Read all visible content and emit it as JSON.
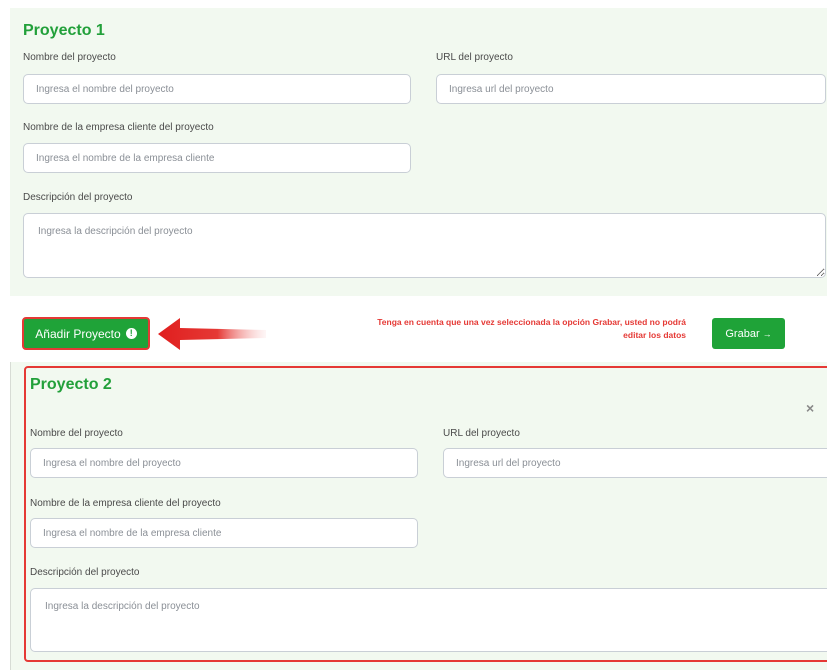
{
  "project1": {
    "title": "Proyecto 1",
    "name_label": "Nombre del proyecto",
    "name_placeholder": "Ingresa el nombre del proyecto",
    "url_label": "URL del proyecto",
    "url_placeholder": "Ingresa url del proyecto",
    "company_label": "Nombre de la empresa cliente del proyecto",
    "company_placeholder": "Ingresa el nombre de la empresa cliente",
    "description_label": "Descripción del proyecto",
    "description_placeholder": "Ingresa la descripción del proyecto"
  },
  "actions": {
    "add_label": "Añadir Proyecto",
    "add_icon": "info-icon",
    "warning_line1": "Tenga en cuenta que una vez seleccionada la opción Grabar, usted no podrá",
    "warning_line2": "editar los datos",
    "save_label": "Grabar",
    "save_arrow": "→"
  },
  "project2": {
    "title": "Proyecto 2",
    "close_glyph": "×",
    "name_label": "Nombre del proyecto",
    "name_placeholder": "Ingresa el nombre del proyecto",
    "url_label": "URL del proyecto",
    "url_placeholder": "Ingresa url del proyecto",
    "company_label": "Nombre de la empresa cliente del proyecto",
    "company_placeholder": "Ingresa el nombre de la empresa cliente",
    "description_label": "Descripción del proyecto",
    "description_placeholder": "Ingresa la descripción del proyecto"
  },
  "colors": {
    "accent_green": "#1fa338",
    "highlight_red": "#e53935",
    "panel_bg": "#f2f9f0"
  }
}
